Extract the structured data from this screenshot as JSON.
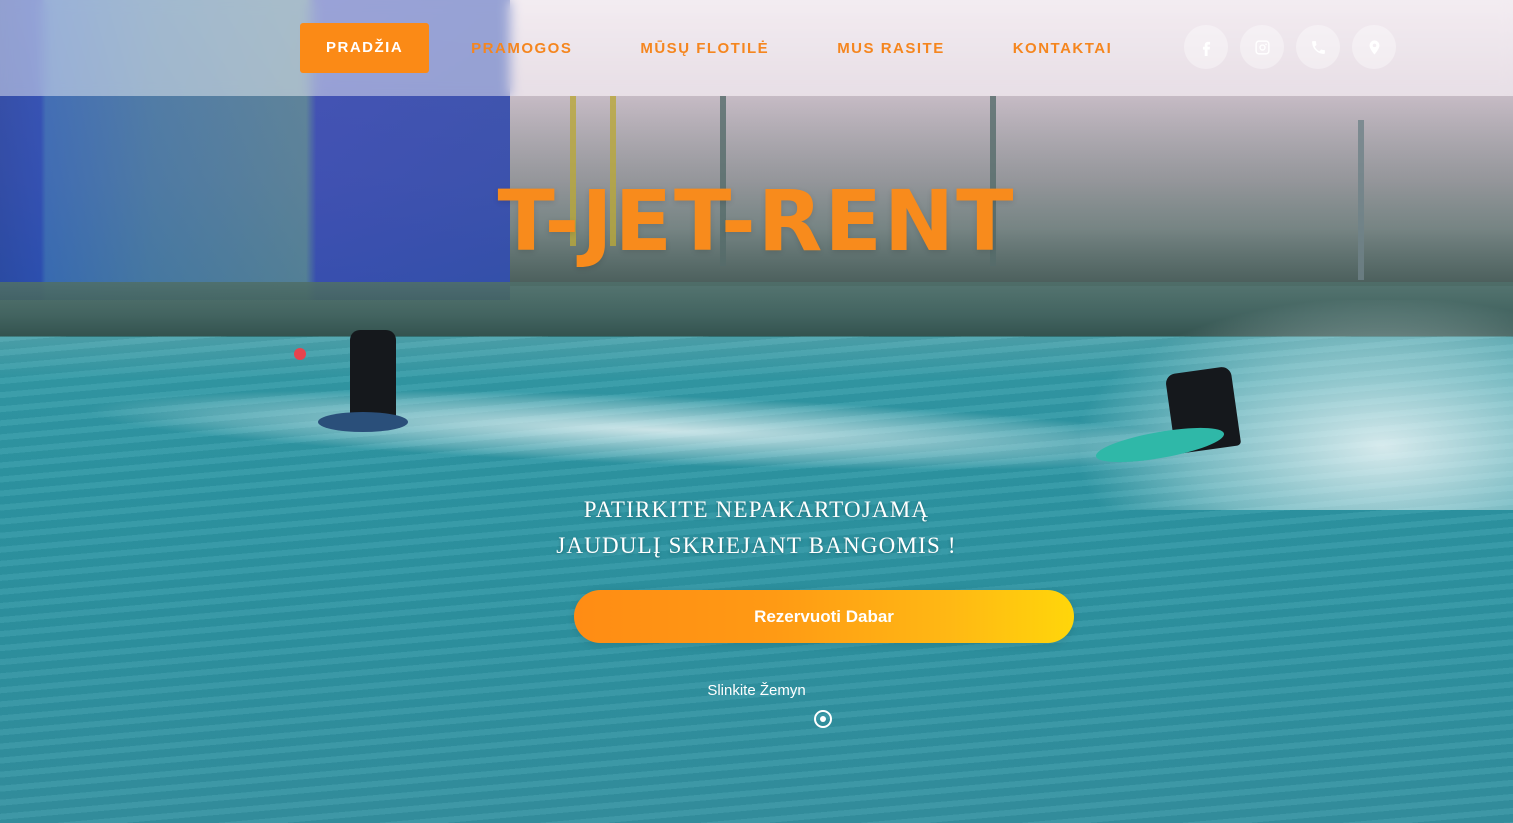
{
  "nav": {
    "items": [
      {
        "label": "PRADŽIA",
        "active": true
      },
      {
        "label": "PRAMOGOS",
        "active": false
      },
      {
        "label": "MŪSŲ FLOTILĖ",
        "active": false
      },
      {
        "label": "MUS RASITE",
        "active": false
      },
      {
        "label": "KONTAKTAI",
        "active": false
      }
    ],
    "social_icons": [
      "facebook-icon",
      "instagram-icon",
      "phone-icon",
      "location-pin-icon"
    ]
  },
  "hero": {
    "brand": "T-JET-RENT",
    "tagline_line1": "PATIRKITE NEPAKARTOJAMĄ",
    "tagline_line2": "JAUDULĮ SKRIEJANT BANGOMIS !",
    "cta_label": "Rezervuoti Dabar",
    "scroll_label": "Slinkite Žemyn"
  },
  "colors": {
    "accent": "#fb8a16",
    "brand": "#f88b1c",
    "cta_gradient_start": "#ff8c14",
    "cta_gradient_end": "#ffd60a"
  }
}
